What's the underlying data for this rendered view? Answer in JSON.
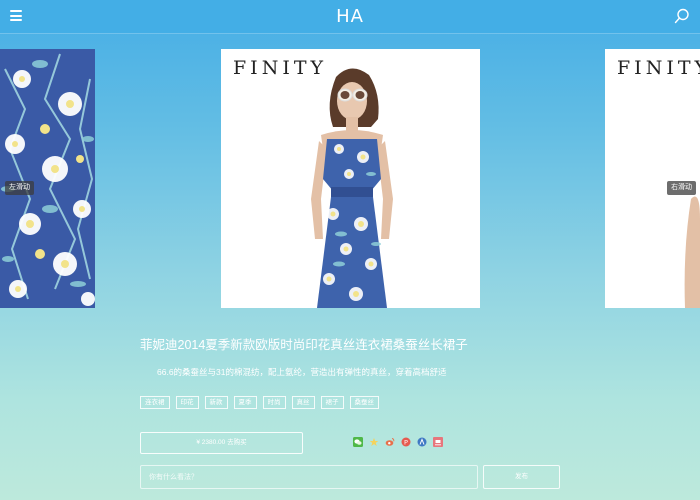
{
  "header": {
    "logo": "HA",
    "menu_icon": "menu-icon",
    "search_icon": "search-icon"
  },
  "carousel": {
    "left_label": "左滑动",
    "right_label": "右滑动",
    "brand": "FINITY"
  },
  "product": {
    "title": "菲妮迪2014夏季新款欧版时尚印花真丝连衣裙桑蚕丝长裙子",
    "description": "66.6的桑蚕丝与31的棉混纺，配上氨纶，营造出有弹性的真丝，穿着高档舒适",
    "tags": [
      "连衣裙",
      "印花",
      "新款",
      "夏季",
      "时尚",
      "真丝",
      "裙子",
      "桑蚕丝"
    ],
    "buy_label": "¥ 2380.00 去购买"
  },
  "share": {
    "icons": [
      "wechat-icon",
      "qzone-icon",
      "weibo-icon",
      "pinterest-icon",
      "renren-icon",
      "douban-icon"
    ]
  },
  "comment": {
    "placeholder": "你有什么看法？",
    "send_label": "发布"
  },
  "colors": {
    "header": "#43aee6",
    "gradient_top": "#45ade6",
    "gradient_bottom": "#bde9dc",
    "print_blue": "#3d5fa8"
  }
}
